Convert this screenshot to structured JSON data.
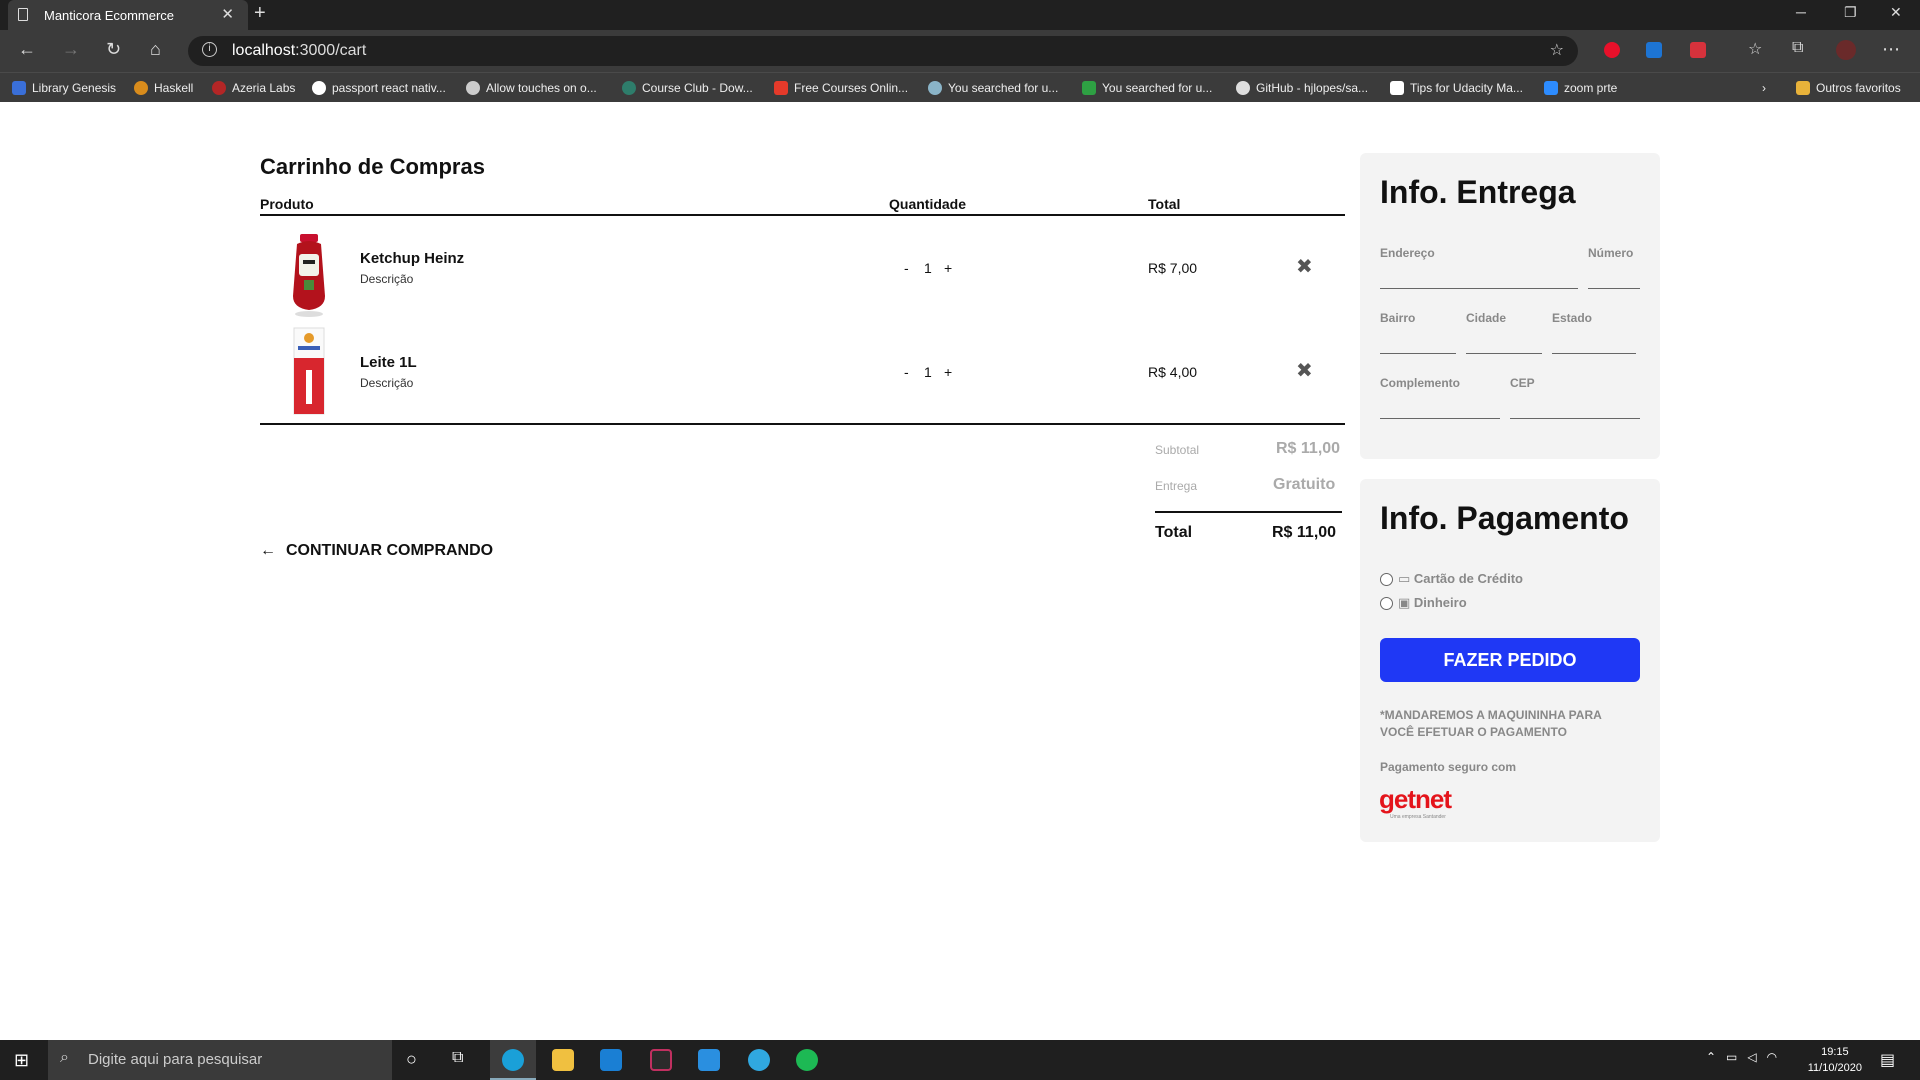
{
  "browser": {
    "tab_title": "Manticora Ecommerce",
    "url_host": "localhost",
    "url_path": ":3000/cart",
    "bookmarks": [
      "Library Genesis",
      "Haskell",
      "Azeria Labs",
      "passport react nativ...",
      "Allow touches on o...",
      "Course Club - Dow...",
      "Free Courses Onlin...",
      "You searched for u...",
      "You searched for u...",
      "GitHub - hjlopes/sa...",
      "Tips for Udacity Ma...",
      "zoom prte"
    ],
    "other_bookmarks": "Outros favoritos"
  },
  "cart": {
    "title": "Carrinho de Compras",
    "headers": {
      "product": "Produto",
      "quantity": "Quantidade",
      "total": "Total"
    },
    "items": [
      {
        "name": "Ketchup Heinz",
        "desc": "Descrição",
        "minus": "-",
        "qty": "1",
        "plus": "+",
        "price": "R$ 7,00"
      },
      {
        "name": "Leite 1L",
        "desc": "Descrição",
        "minus": "-",
        "qty": "1",
        "plus": "+",
        "price": "R$ 4,00"
      }
    ],
    "subtotal_label": "Subtotal",
    "subtotal_value": "R$ 11,00",
    "shipping_label": "Entrega",
    "shipping_value": "Gratuito",
    "total_label": "Total",
    "total_value": "R$ 11,00",
    "continue": "CONTINUAR COMPRANDO"
  },
  "delivery": {
    "title": "Info. Entrega",
    "fields": {
      "address": "Endereço",
      "number": "Número",
      "district": "Bairro",
      "city": "Cidade",
      "state": "Estado",
      "complement": "Complemento",
      "zip": "CEP"
    }
  },
  "payment": {
    "title": "Info. Pagamento",
    "options": [
      "Cartão de Crédito",
      "Dinheiro"
    ],
    "button": "FAZER PEDIDO",
    "note": "*MANDAREMOS A MAQUININHA PARA VOCÊ EFETUAR O PAGAMENTO",
    "secure": "Pagamento seguro com",
    "logo": "getnet",
    "logo_sub": "Uma empresa Santander"
  },
  "taskbar": {
    "search_placeholder": "Digite aqui para pesquisar",
    "time": "19:15",
    "date": "11/10/2020"
  }
}
